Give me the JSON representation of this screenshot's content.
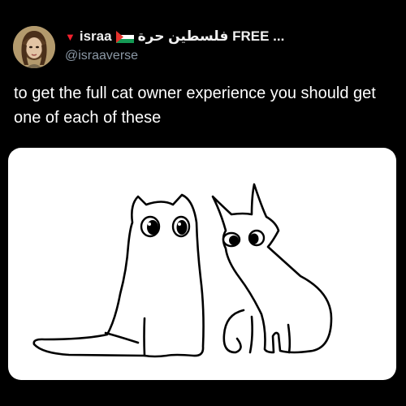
{
  "tweet": {
    "author": {
      "name_prefix_icon": "red-triangle-icon",
      "name": "israa",
      "flag_icon": "palestine-flag-icon",
      "name_suffix": "فلسطين حرة FREE ...",
      "handle": "@israaverse"
    },
    "text": "to get the full cat owner experience you should get one of each of these",
    "media": {
      "kind": "drawing",
      "subject": "two cat doodles"
    }
  },
  "colors": {
    "background": "#000000",
    "text": "#ffffff",
    "handle": "#8b98a5",
    "accent_red": "#f4212e"
  }
}
